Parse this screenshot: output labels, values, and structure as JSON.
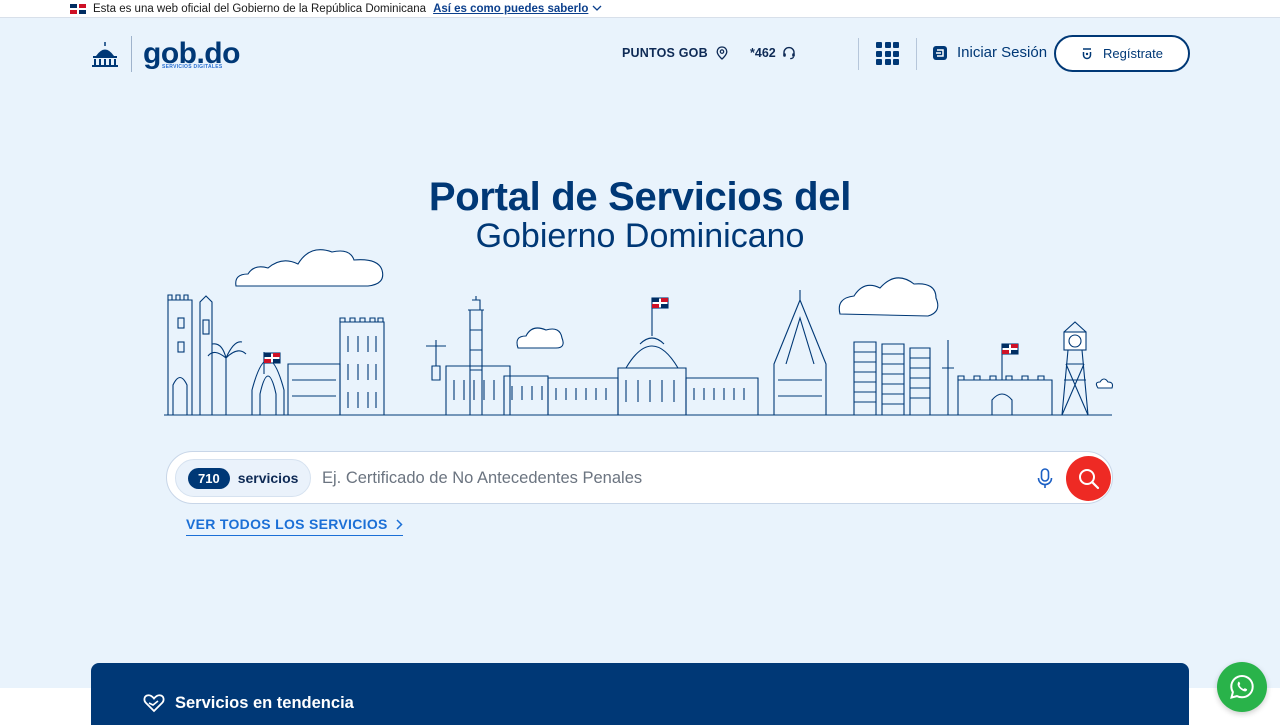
{
  "banner": {
    "text": "Esta es una web oficial del Gobierno de la República Dominicana",
    "link": "Así es como puedes saberlo"
  },
  "header": {
    "logo_brand": "gob.do",
    "logo_sub": "SERVICIOS DIGITALES",
    "puntos": "PUNTOS GOB",
    "phone": "*462",
    "login": "Iniciar Sesión",
    "register": "Regístrate"
  },
  "hero": {
    "title_line1": "Portal de Servicios del",
    "title_line2": "Gobierno Dominicano"
  },
  "search": {
    "count": "710",
    "count_label": "servicios",
    "placeholder": "Ej. Certificado de No Antecedentes Penales",
    "see_all": "VER TODOS LOS SERVICIOS"
  },
  "trending": {
    "title": "Servicios en tendencia"
  },
  "colors": {
    "primary": "#003876",
    "accent_red": "#ee2a24",
    "link_blue": "#1b6fd6",
    "background": "#e9f3fc",
    "whatsapp": "#29b34a"
  },
  "icons": [
    "dr-flag-icon",
    "chevron-down-icon",
    "seal-icon",
    "location-pin-icon",
    "headset-icon",
    "apps-grid-icon",
    "login-icon",
    "register-icon",
    "mic-icon",
    "search-icon",
    "chevron-right-icon",
    "heart-hand-icon",
    "whatsapp-icon"
  ]
}
